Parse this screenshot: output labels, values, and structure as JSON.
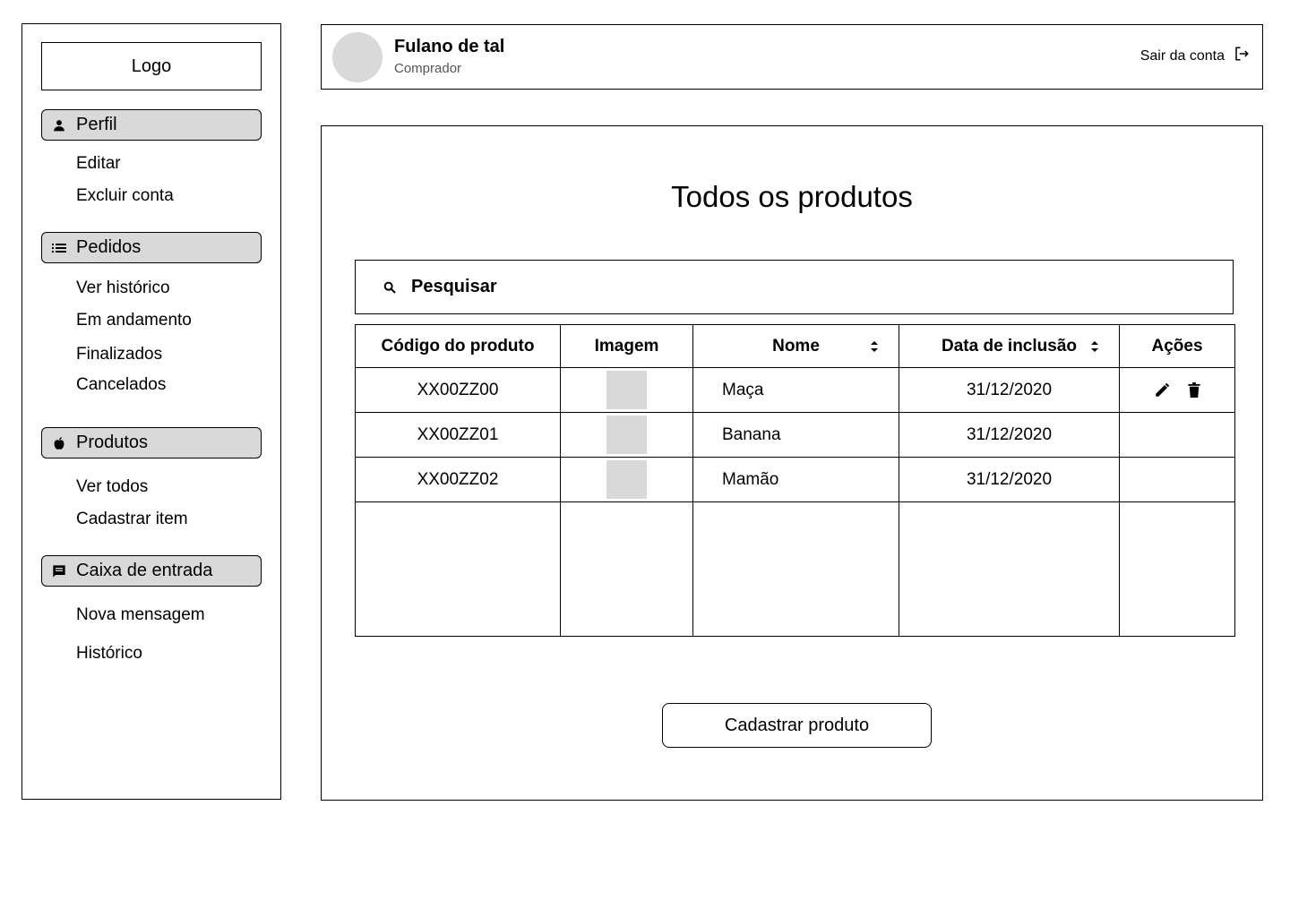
{
  "sidebar": {
    "logo": "Logo",
    "sections": [
      {
        "label": "Perfil",
        "icon": "person-icon",
        "items": [
          "Editar",
          "Excluir conta"
        ]
      },
      {
        "label": "Pedidos",
        "icon": "list-icon",
        "items": [
          "Ver histórico",
          "Em andamento",
          "Finalizados",
          "Cancelados"
        ]
      },
      {
        "label": "Produtos",
        "icon": "apple-icon",
        "items": [
          "Ver todos",
          "Cadastrar item"
        ]
      },
      {
        "label": "Caixa de entrada",
        "icon": "message-icon",
        "items": [
          "Nova mensagem",
          "Histórico"
        ]
      }
    ]
  },
  "header": {
    "user_name": "Fulano de tal",
    "user_role": "Comprador",
    "logout_label": "Sair da conta"
  },
  "main": {
    "title": "Todos os produtos",
    "search_placeholder": "Pesquisar",
    "columns": [
      "Código do produto",
      "Imagem",
      "Nome",
      "Data de inclusão",
      "Ações"
    ],
    "rows": [
      {
        "code": "XX00ZZ00",
        "name": "Maça",
        "date": "31/12/2020"
      },
      {
        "code": "XX00ZZ01",
        "name": "Banana",
        "date": "31/12/2020"
      },
      {
        "code": "XX00ZZ02",
        "name": "Mamão",
        "date": "31/12/2020"
      }
    ],
    "cta_label": "Cadastrar produto"
  },
  "colors": {
    "fill_gray": "#d9d9d9",
    "border": "#000000",
    "muted_text": "#555555"
  }
}
